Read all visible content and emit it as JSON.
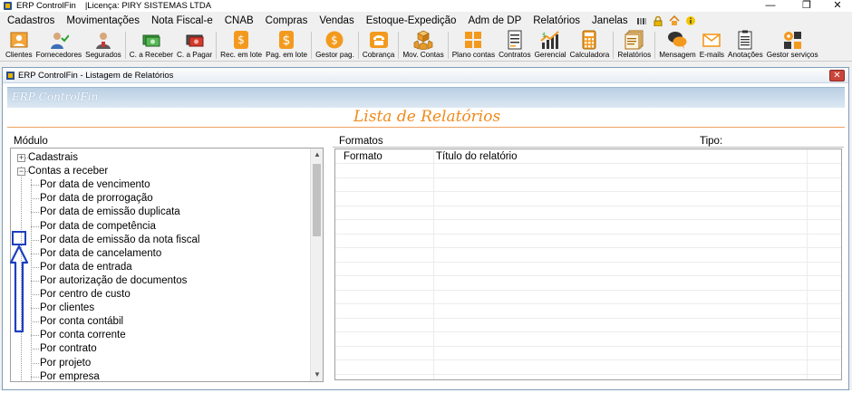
{
  "window": {
    "app_name": "ERP ControlFin",
    "license": "|Licença: PIRY SISTEMAS LTDA",
    "controls": {
      "minimize": "—",
      "restore": "❐",
      "close": "✕"
    }
  },
  "menu": [
    "Cadastros",
    "Movimentações",
    "Nota Fiscal-e",
    "CNAB",
    "Compras",
    "Vendas",
    "Estoque-Expedição",
    "Adm de DP",
    "Relatórios",
    "Janelas"
  ],
  "menu_icons": [
    "grid-icon",
    "lock-icon",
    "home-icon",
    "info-icon"
  ],
  "toolbar": [
    {
      "label": "Clientes",
      "icon": "clients-icon"
    },
    {
      "label": "Fornecedores",
      "icon": "suppliers-icon"
    },
    {
      "label": "Segurados",
      "icon": "insured-icon"
    },
    {
      "label": "C. a Receber",
      "icon": "receivable-icon"
    },
    {
      "label": "C. a Pagar",
      "icon": "payable-icon"
    },
    {
      "label": "Rec. em lote",
      "icon": "batch-receive-icon"
    },
    {
      "label": "Pag. em lote",
      "icon": "batch-pay-icon"
    },
    {
      "label": "Gestor pag.",
      "icon": "payment-manager-icon"
    },
    {
      "label": "Cobrança",
      "icon": "billing-icon"
    },
    {
      "label": "Mov. Contas",
      "icon": "account-movement-icon"
    },
    {
      "label": "Plano contas",
      "icon": "chart-of-accounts-icon"
    },
    {
      "label": "Contratos",
      "icon": "contracts-icon"
    },
    {
      "label": "Gerencial",
      "icon": "management-icon"
    },
    {
      "label": "Calculadora",
      "icon": "calculator-icon"
    },
    {
      "label": "Relatórios",
      "icon": "reports-icon"
    },
    {
      "label": "Mensagem",
      "icon": "message-icon"
    },
    {
      "label": "E-mails",
      "icon": "email-icon"
    },
    {
      "label": "Anotações",
      "icon": "notes-icon"
    },
    {
      "label": "Gestor serviços",
      "icon": "services-manager-icon"
    }
  ],
  "inner_window": {
    "title": "ERP ControlFin - Listagem de Relatórios",
    "banner": "ERP ControlFin",
    "heading": "Lista de Relatórios"
  },
  "left_panel": {
    "label": "Módulo",
    "tree": [
      {
        "label": "Cadastrais",
        "expander": "+",
        "level": 0
      },
      {
        "label": "Contas a receber",
        "expander": "−",
        "level": 0
      },
      {
        "label": "Por data de vencimento",
        "level": 1
      },
      {
        "label": "Por data de prorrogação",
        "level": 1
      },
      {
        "label": "Por data de emissão duplicata",
        "level": 1
      },
      {
        "label": "Por data de competência",
        "level": 1
      },
      {
        "label": "Por data de emissão da nota fiscal",
        "level": 1
      },
      {
        "label": "Por data de cancelamento",
        "level": 1
      },
      {
        "label": "Por data de entrada",
        "level": 1
      },
      {
        "label": "Por autorização de documentos",
        "level": 1
      },
      {
        "label": "Por centro de custo",
        "level": 1
      },
      {
        "label": "Por clientes",
        "level": 1
      },
      {
        "label": "Por conta contábil",
        "level": 1
      },
      {
        "label": "Por conta corrente",
        "level": 1
      },
      {
        "label": "Por contrato",
        "level": 1
      },
      {
        "label": "Por projeto",
        "level": 1
      },
      {
        "label": "Por empresa",
        "level": 1
      }
    ]
  },
  "right_panel": {
    "label": "Formatos",
    "type_label": "Tipo:",
    "columns": [
      "Formato",
      "Título do relatório"
    ]
  },
  "colors": {
    "accent_orange": "#f08a1b",
    "highlight_blue": "#1e3fbf",
    "close_red": "#c9453a"
  }
}
